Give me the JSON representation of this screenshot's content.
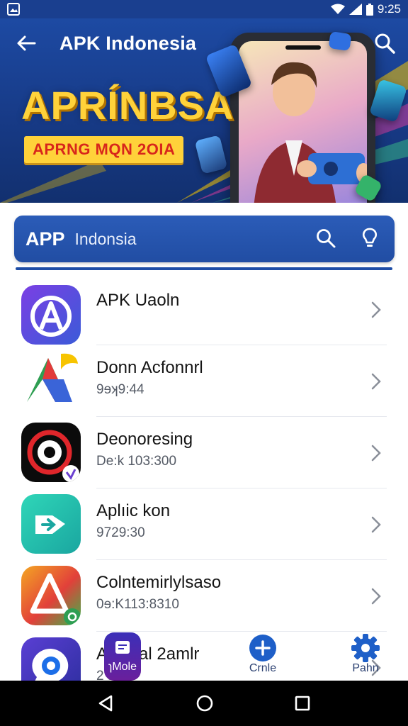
{
  "status_bar": {
    "time": "9:25"
  },
  "app_bar": {
    "title": "APK Indonesia"
  },
  "banner": {
    "headline": "APRÍNBSA",
    "ribbon": "APRNG MQN 2OIA"
  },
  "search_bar": {
    "brand": "APP",
    "label": "Indonsia"
  },
  "apps": [
    {
      "name": "APK Uaoln",
      "sub": "",
      "icon": "letter-a-app-icon"
    },
    {
      "name": "Donn Acfonnrl",
      "sub": "9ɘʞ9:44",
      "icon": "arrow-app-icon"
    },
    {
      "name": "Deonoresing",
      "sub": "De:k 103:300",
      "icon": "target-app-icon"
    },
    {
      "name": "Aplıic kon",
      "sub": "9729:30",
      "icon": "arrow-tag-app-icon"
    },
    {
      "name": "Colntemirlylsaso",
      "sub": "0ɘ:K113:8310",
      "icon": "triangle-app-icon"
    },
    {
      "name": "Al pinal 2amlr",
      "sub": "2 ɜ0",
      "icon": "chat-bubble-app-icon"
    }
  ],
  "bottom_tabs": [
    {
      "label": "ɿMole",
      "icon": "message-icon"
    },
    {
      "label": "Crnle",
      "icon": "plus-icon"
    },
    {
      "label": "Pahn",
      "icon": "gear-icon"
    }
  ],
  "colors": {
    "primary": "#1d4aa3",
    "accent": "#ffd23a",
    "ribbon_text": "#d8261b"
  }
}
